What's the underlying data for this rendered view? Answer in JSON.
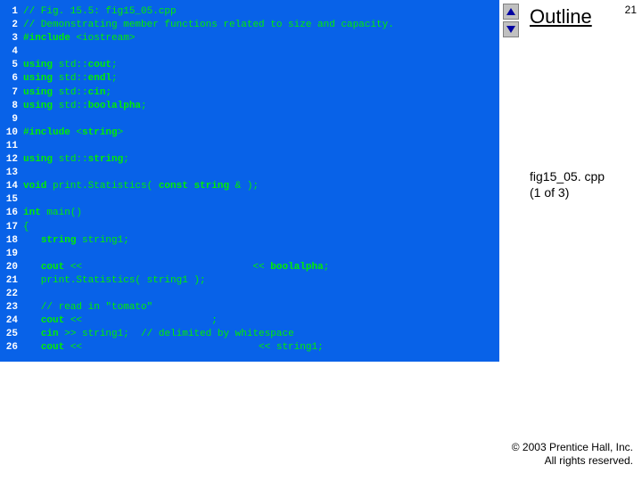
{
  "right": {
    "outline_label": "Outline",
    "page_number": "21",
    "file_label_line1": "fig15_05. cpp",
    "file_label_line2": "(1 of 3)"
  },
  "copyright": {
    "line1": "© 2003 Prentice Hall, Inc.",
    "line2": "All rights reserved."
  },
  "lines": [
    {
      "n": "1",
      "t": "// Fig. 15.5: fig15_05.cpp"
    },
    {
      "n": "2",
      "t": "// Demonstrating member functions related to size and capacity."
    },
    {
      "n": "3",
      "t": "#include <iostream>"
    },
    {
      "n": "4",
      "t": ""
    },
    {
      "n": "5",
      "t": "using std::cout;"
    },
    {
      "n": "6",
      "t": "using std::endl;"
    },
    {
      "n": "7",
      "t": "using std::cin;"
    },
    {
      "n": "8",
      "t": "using std::boolalpha;"
    },
    {
      "n": "9",
      "t": ""
    },
    {
      "n": "10",
      "t": "#include <string>"
    },
    {
      "n": "11",
      "t": ""
    },
    {
      "n": "12",
      "t": "using std::string;"
    },
    {
      "n": "13",
      "t": ""
    },
    {
      "n": "14",
      "t": "void print.Statistics( const string & );"
    },
    {
      "n": "15",
      "t": ""
    },
    {
      "n": "16",
      "t": "int main()"
    },
    {
      "n": "17",
      "t": "{"
    },
    {
      "n": "18",
      "t": "   string string1;"
    },
    {
      "n": "19",
      "t": ""
    },
    {
      "n": "20",
      "t": "   cout <<                             << boolalpha;"
    },
    {
      "n": "21",
      "t": "   print.Statistics( string1 );"
    },
    {
      "n": "22",
      "t": ""
    },
    {
      "n": "23",
      "t": "   // read in \"tomato\""
    },
    {
      "n": "24",
      "t": "   cout <<                      ;"
    },
    {
      "n": "25",
      "t": "   cin >> string1;  // delimited by whitespace"
    },
    {
      "n": "26",
      "t": "   cout <<                              << string1;"
    }
  ],
  "keywords": [
    "#include",
    "using",
    "void",
    "const",
    "int",
    "string",
    "cout",
    "cin",
    "endl",
    "boolalpha"
  ]
}
